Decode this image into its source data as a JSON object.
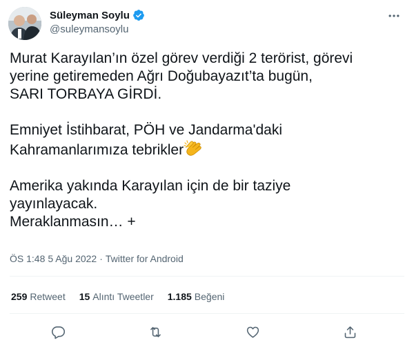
{
  "author": {
    "display_name": "Süleyman Soylu",
    "handle": "@suleymansoylu",
    "verified": true,
    "avatar_icon": "profile-photo"
  },
  "tweet": {
    "paragraphs": [
      {
        "lines": [
          "Murat Karayılan’ın özel görev verdiği 2 terörist, görevi",
          "yerine getiremeden Ağrı Doğubayazıt’ta bugün,",
          "SARI TORBAYA GİRDİ."
        ]
      },
      {
        "lines": [
          "Emniyet İstihbarat, PÖH ve Jandarma'daki",
          "Kahramanlarımıza tebrikler"
        ],
        "trailing_emoji": "clapping-hands"
      },
      {
        "lines": [
          "Amerika yakında Karayılan için de bir taziye",
          "yayınlayacak.",
          "Meraklanmasın… +"
        ]
      }
    ]
  },
  "meta": {
    "time": "ÖS 1:48",
    "separator": "·",
    "date": "5 Ağu 2022",
    "source": "Twitter for Android"
  },
  "stats": {
    "retweets_count": "259",
    "retweets_label": "Retweet",
    "quotes_count": "15",
    "quotes_label": "Alıntı Tweetler",
    "likes_count": "1.185",
    "likes_label": "Beğeni"
  },
  "actions": [
    "reply-icon",
    "retweet-icon",
    "like-icon",
    "share-icon"
  ],
  "colors": {
    "text": "#0f1419",
    "secondary": "#536471",
    "verified": "#1d9bf0",
    "divider": "#eff3f4"
  }
}
